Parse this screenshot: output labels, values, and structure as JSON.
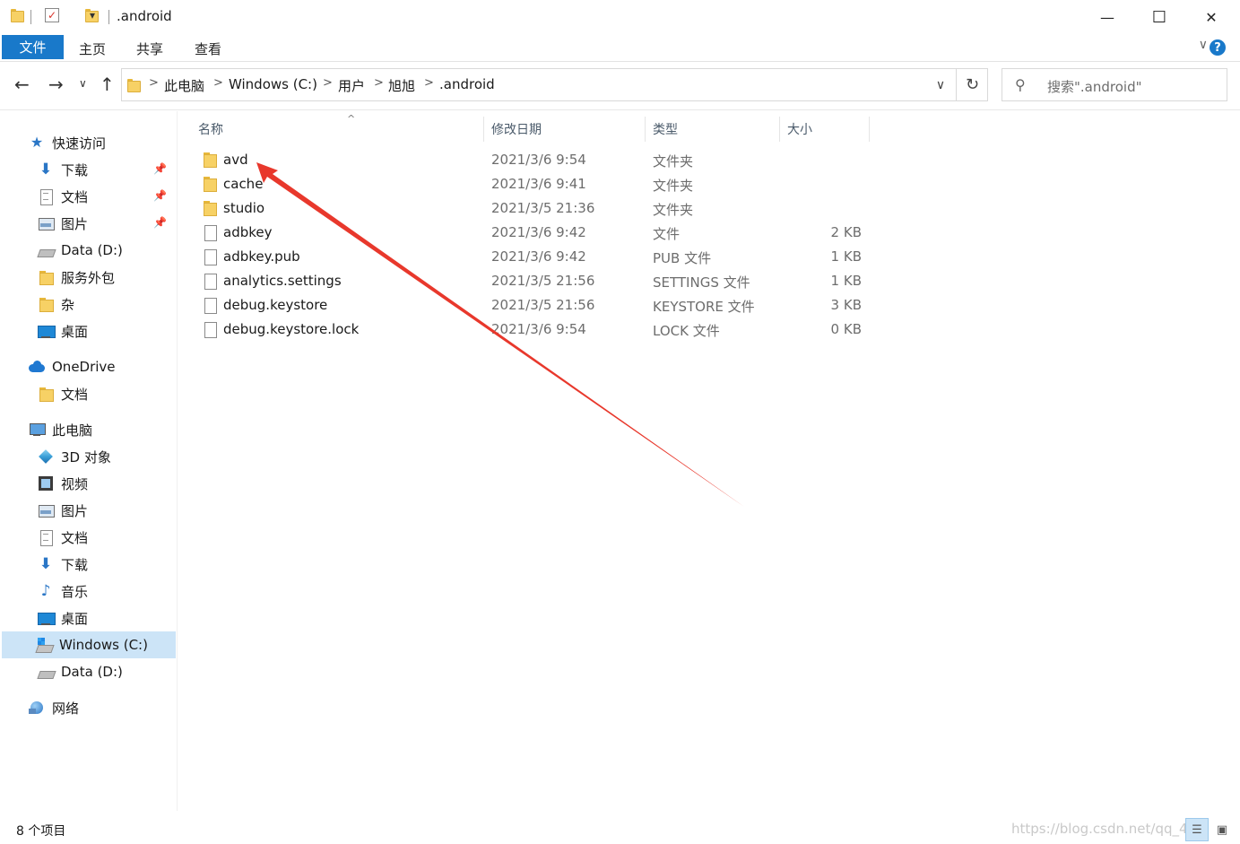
{
  "window": {
    "title": ".android",
    "minimize_glyph": "—",
    "maximize_glyph": "☐",
    "close_glyph": "✕",
    "qa_dropdown_glyph": "▾"
  },
  "ribbon": {
    "tabs": [
      "文件",
      "主页",
      "共享",
      "查看"
    ],
    "collapse_glyph": "∨",
    "help_glyph": "?"
  },
  "nav": {
    "back_glyph": "←",
    "forward_glyph": "→",
    "recent_glyph": "∨",
    "up_glyph": "↑",
    "breadcrumbs": [
      "此电脑",
      "Windows (C:)",
      "用户",
      "旭旭",
      ".android"
    ],
    "crumb_sep": ">",
    "dropdown_glyph": "∨",
    "refresh_glyph": "↻",
    "search_glyph": "⚲",
    "search_placeholder": "搜索\".android\""
  },
  "sidebar": {
    "quick_access": {
      "label": "快速访问",
      "icon": "star-icon"
    },
    "quick_items": [
      {
        "label": "下载",
        "icon": "download-icon",
        "pinned": true
      },
      {
        "label": "文档",
        "icon": "document-icon",
        "pinned": true
      },
      {
        "label": "图片",
        "icon": "picture-icon",
        "pinned": true
      },
      {
        "label": "Data (D:)",
        "icon": "drive-icon",
        "pinned": false
      },
      {
        "label": "服务外包",
        "icon": "folder-icon",
        "pinned": false
      },
      {
        "label": "杂",
        "icon": "folder-icon",
        "pinned": false
      },
      {
        "label": "桌面",
        "icon": "desktop-icon",
        "pinned": false
      }
    ],
    "pin_glyph": "📌",
    "onedrive": {
      "label": "OneDrive",
      "icon": "cloud-icon"
    },
    "onedrive_items": [
      {
        "label": "文档",
        "icon": "folder-icon"
      }
    ],
    "this_pc": {
      "label": "此电脑",
      "icon": "computer-icon"
    },
    "pc_items": [
      {
        "label": "3D 对象",
        "icon": "3d-objects-icon"
      },
      {
        "label": "视频",
        "icon": "video-icon"
      },
      {
        "label": "图片",
        "icon": "picture-icon"
      },
      {
        "label": "文档",
        "icon": "document-icon"
      },
      {
        "label": "下载",
        "icon": "download-icon"
      },
      {
        "label": "音乐",
        "icon": "music-icon"
      },
      {
        "label": "桌面",
        "icon": "desktop-icon"
      },
      {
        "label": "Windows (C:)",
        "icon": "windows-drive-icon",
        "selected": true
      },
      {
        "label": "Data (D:)",
        "icon": "drive-icon"
      }
    ],
    "network": {
      "label": "网络",
      "icon": "network-icon"
    }
  },
  "columns": {
    "name": "名称",
    "date": "修改日期",
    "type": "类型",
    "size": "大小",
    "sort_glyph": "^"
  },
  "files": [
    {
      "name": "avd",
      "date": "2021/3/6 9:54",
      "type": "文件夹",
      "size": "",
      "kind": "folder"
    },
    {
      "name": "cache",
      "date": "2021/3/6 9:41",
      "type": "文件夹",
      "size": "",
      "kind": "folder"
    },
    {
      "name": "studio",
      "date": "2021/3/5 21:36",
      "type": "文件夹",
      "size": "",
      "kind": "folder"
    },
    {
      "name": "adbkey",
      "date": "2021/3/6 9:42",
      "type": "文件",
      "size": "2 KB",
      "kind": "file"
    },
    {
      "name": "adbkey.pub",
      "date": "2021/3/6 9:42",
      "type": "PUB 文件",
      "size": "1 KB",
      "kind": "file"
    },
    {
      "name": "analytics.settings",
      "date": "2021/3/5 21:56",
      "type": "SETTINGS 文件",
      "size": "1 KB",
      "kind": "file"
    },
    {
      "name": "debug.keystore",
      "date": "2021/3/5 21:56",
      "type": "KEYSTORE 文件",
      "size": "3 KB",
      "kind": "file"
    },
    {
      "name": "debug.keystore.lock",
      "date": "2021/3/6 9:54",
      "type": "LOCK 文件",
      "size": "0 KB",
      "kind": "file"
    }
  ],
  "status": {
    "count": "8 个项目",
    "watermark": "https://blog.csdn.net/qq_48",
    "details_view_glyph": "☰",
    "large_icons_glyph": "▣"
  },
  "annotation": {
    "color": "#e8382c"
  }
}
